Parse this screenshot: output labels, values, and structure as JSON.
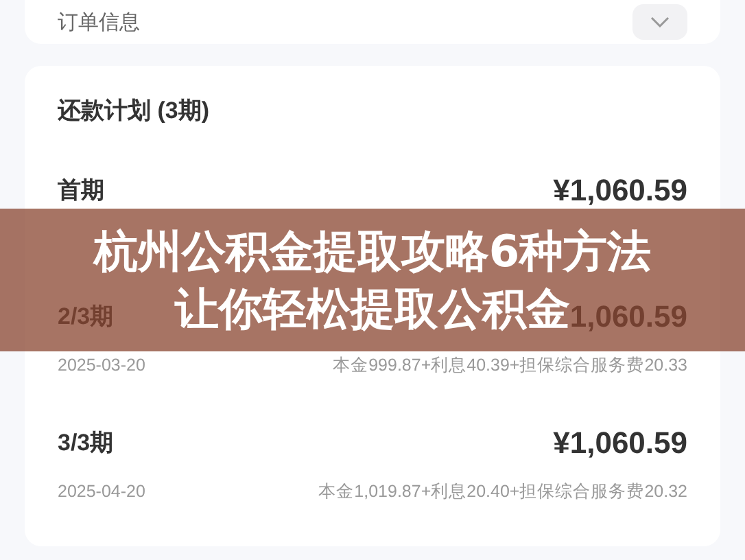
{
  "order_section": {
    "title": "订单信息"
  },
  "plan": {
    "title": "还款计划 (3期)",
    "rows": [
      {
        "period": "首期",
        "amount": "¥1,060.59"
      },
      {
        "period": "2/3期",
        "amount": "1,060.59",
        "date": "2025-03-20",
        "breakdown": "本金999.87+利息40.39+担保综合服务费20.33"
      },
      {
        "period": "3/3期",
        "amount": "¥1,060.59",
        "date": "2025-04-20",
        "breakdown": "本金1,019.87+利息20.40+担保综合服务费20.32"
      }
    ]
  },
  "banner": {
    "lines": [
      "杭州公积金提取攻略6种方法",
      "让你轻松提取公积金"
    ]
  }
}
